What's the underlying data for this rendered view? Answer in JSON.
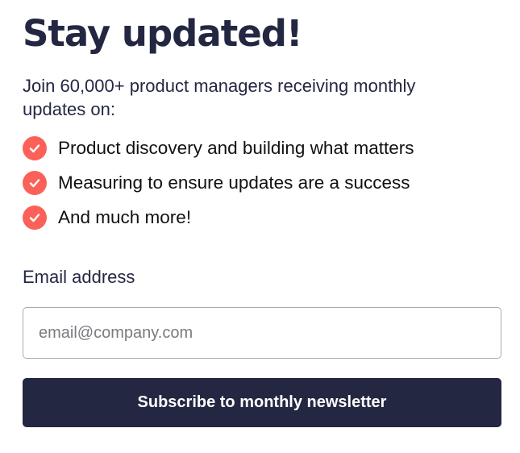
{
  "signup": {
    "title": "Stay updated!",
    "intro": "Join 60,000+ product managers receiving monthly updates on:",
    "benefits": [
      {
        "text": "Product discovery and building what matters",
        "icon": "check-circle-icon"
      },
      {
        "text": "Measuring to ensure updates are a success",
        "icon": "check-circle-icon"
      },
      {
        "text": "And much more!",
        "icon": "check-circle-icon"
      }
    ],
    "email_label": "Email address",
    "email_placeholder": "email@company.com",
    "email_value": "",
    "submit_label": "Subscribe to monthly newsletter"
  },
  "colors": {
    "accent": "#fb6158",
    "primary": "#242742",
    "text": "#242742",
    "input_border": "#a9a9ae"
  }
}
